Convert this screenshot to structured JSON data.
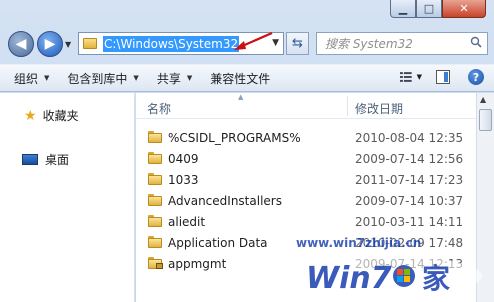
{
  "address": {
    "path": "C:\\Windows\\System32"
  },
  "search": {
    "placeholder": "搜索 System32"
  },
  "toolbar": {
    "organize": "组织",
    "include": "包含到库中",
    "share": "共享",
    "compat": "兼容性文件"
  },
  "nav": {
    "favorites": "收藏夹",
    "desktop": "桌面"
  },
  "columns": {
    "name": "名称",
    "date": "修改日期"
  },
  "files": [
    {
      "name": "%CSIDL_PROGRAMS%",
      "date": "2010-08-04 12:35",
      "icon": "folder-icon"
    },
    {
      "name": "0409",
      "date": "2009-07-14 12:56",
      "icon": "folder-icon"
    },
    {
      "name": "1033",
      "date": "2011-07-14 17:23",
      "icon": "folder-icon"
    },
    {
      "name": "AdvancedInstallers",
      "date": "2009-07-14 10:37",
      "icon": "folder-icon"
    },
    {
      "name": "aliedit",
      "date": "2010-03-11 14:11",
      "icon": "folder-icon"
    },
    {
      "name": "Application Data",
      "date": "2010-02-09 17:48",
      "icon": "folder-icon"
    },
    {
      "name": "appmgmt",
      "date": "2009-07-14 12:13",
      "icon": "locked-folder-icon"
    }
  ],
  "watermark": {
    "url": "www.win7zhijia.cn",
    "logo": "Win7之家"
  },
  "colors": {
    "selection": "#3399ff",
    "annotation_arrow": "#cc1010",
    "watermark": "#1a3fb0"
  }
}
